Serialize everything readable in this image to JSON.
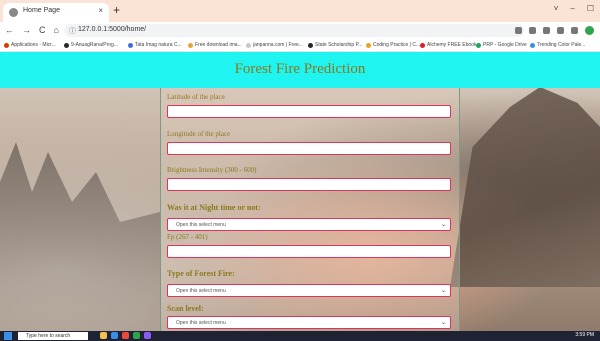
{
  "browser": {
    "tab_title": "Home Page",
    "tab_close": "×",
    "new_tab": "+",
    "window_controls": [
      "˅",
      "–",
      "☐"
    ],
    "nav": [
      "←",
      "→",
      "C",
      "⌂"
    ],
    "url": "127.0.0.1:5000/home/",
    "bookmarks": [
      {
        "label": "Applications - Micr...",
        "color": "#d83b01"
      },
      {
        "label": "9-AnuagRana/Prog...",
        "color": "#24292e"
      },
      {
        "label": "Tata Imag natura C...",
        "color": "#3b6fd8"
      },
      {
        "label": "Free download ima...",
        "color": "#e8a33b"
      },
      {
        "label": "janpanna.com | Free...",
        "color": "#c8c8c8"
      },
      {
        "label": "State Scholarship P...",
        "color": "#24292e"
      },
      {
        "label": "Coding Practice | C...",
        "color": "#f0a020"
      },
      {
        "label": "Alchemy FREE Ebook...",
        "color": "#d81f26"
      },
      {
        "label": "PRP - Google Drive",
        "color": "#1fa463"
      },
      {
        "label": "Trending Color Pale...",
        "color": "#3b8ee8"
      }
    ]
  },
  "page": {
    "title": "Forest Fire Prediction",
    "fields": [
      {
        "label": "Latitude of the place",
        "kind": "input",
        "value": ""
      },
      {
        "label": "Longitude of the place",
        "kind": "input",
        "value": ""
      },
      {
        "label": "Brightness Intensity (300 - 600)",
        "kind": "input",
        "value": ""
      },
      {
        "label": "Was it at Night time or not:",
        "kind": "select",
        "value": "Open this select menu",
        "bold": true
      },
      {
        "label": "Fp (267 - 401)",
        "kind": "input",
        "value": ""
      },
      {
        "label": "Type of Forest Fire:",
        "kind": "select",
        "value": "Open this select menu",
        "bold": true
      },
      {
        "label": "Scan level:",
        "kind": "select",
        "value": "Open this select menu",
        "bold": true
      }
    ]
  },
  "taskbar": {
    "search_placeholder": "Type here to search",
    "clock": "3:59 PM"
  }
}
